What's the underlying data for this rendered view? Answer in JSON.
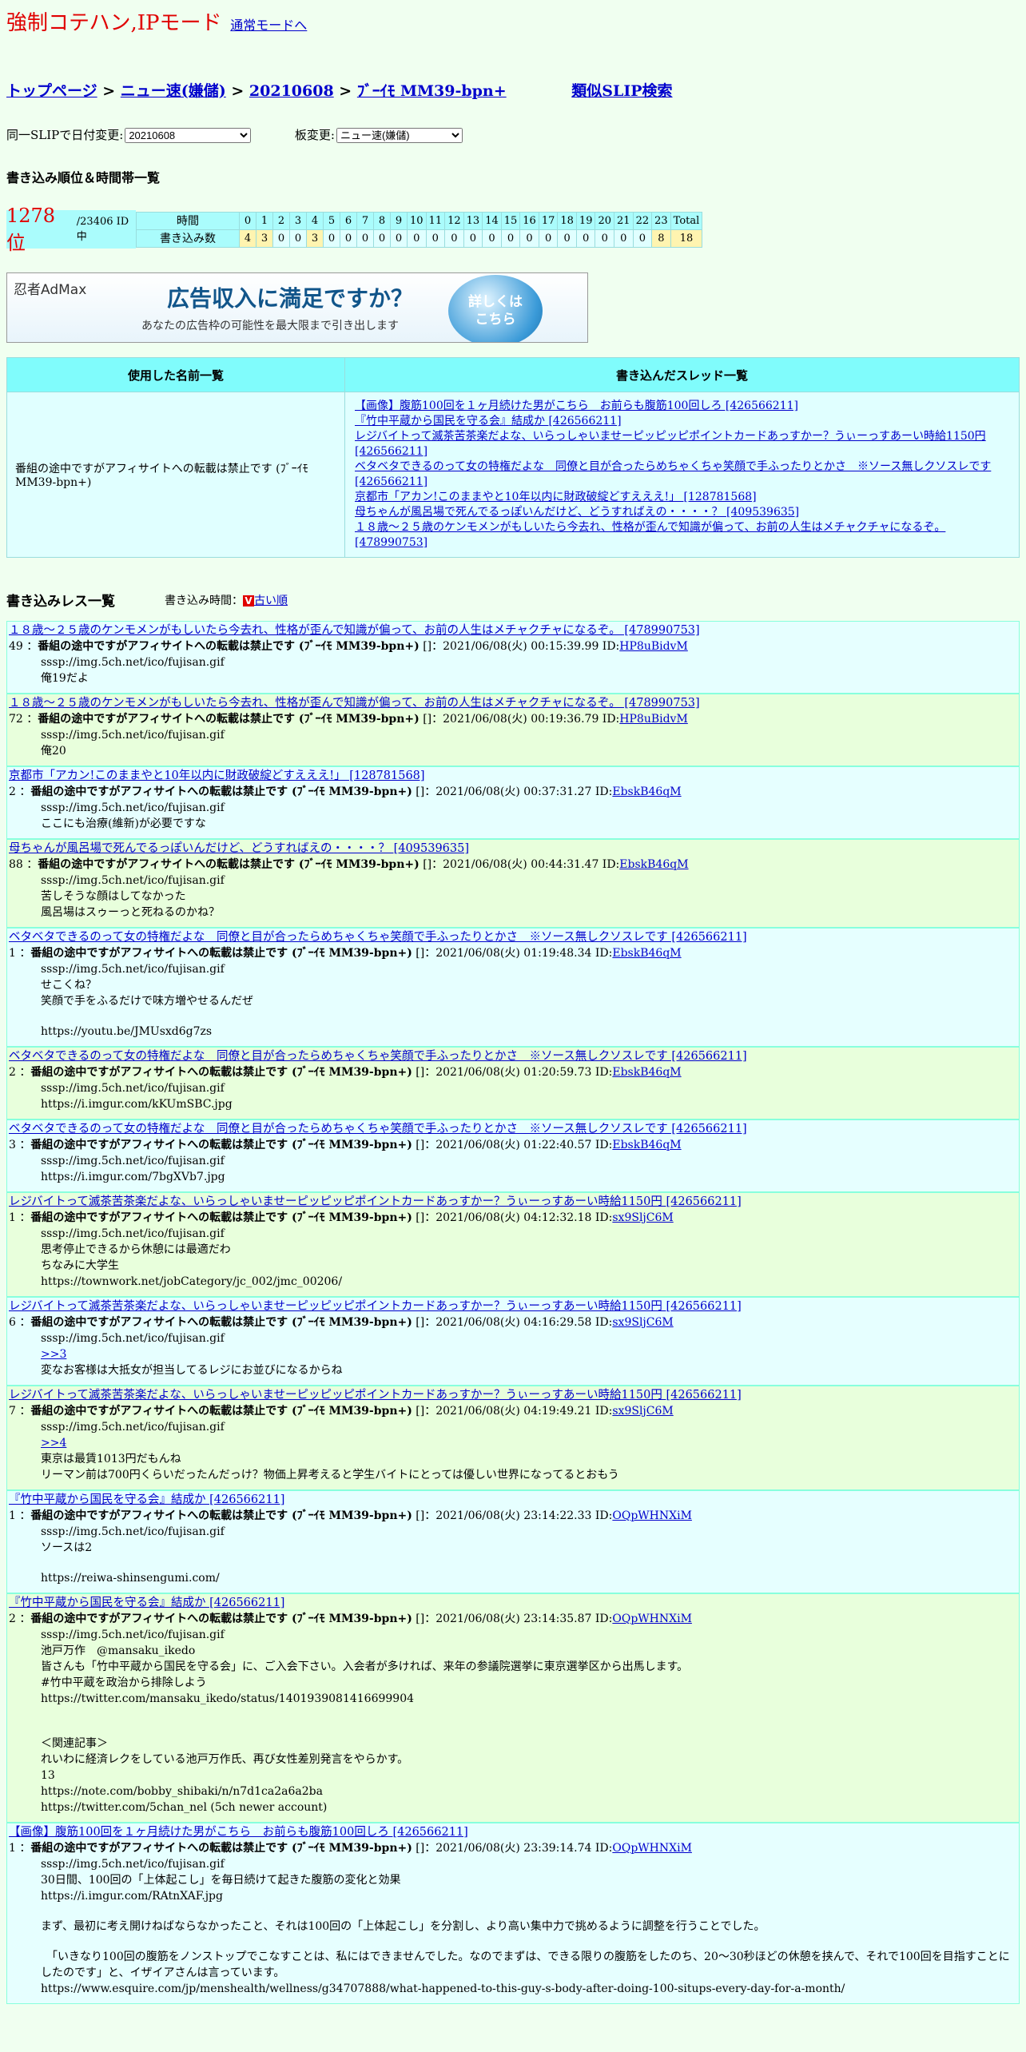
{
  "header": {
    "title": "強制コテハン,IPモード",
    "mode_link": "通常モードへ"
  },
  "breadcrumb": {
    "top": "トップページ",
    "board": "ニュー速(嫌儲)",
    "date": "20210608",
    "slip": "ﾌﾞｰｲﾓ MM39-bpn+",
    "similar": "類似SLIP検索",
    "sep": " > "
  },
  "controls": {
    "date_label": "同一SLIPで日付変更:",
    "date_value": "20210608",
    "board_label": "板変更:",
    "board_value": "ニュー速(嫌儲)"
  },
  "ranking": {
    "heading": "書き込み順位＆時間帯一覧",
    "rank": "1278 位",
    "total": "/23406 ID中",
    "time_label": "時間",
    "count_label": "書き込み数",
    "hours": [
      "0",
      "1",
      "2",
      "3",
      "4",
      "5",
      "6",
      "7",
      "8",
      "9",
      "10",
      "11",
      "12",
      "13",
      "14",
      "15",
      "16",
      "17",
      "18",
      "19",
      "20",
      "21",
      "22",
      "23",
      "Total"
    ],
    "counts": [
      "4",
      "3",
      "0",
      "0",
      "3",
      "0",
      "0",
      "0",
      "0",
      "0",
      "0",
      "0",
      "0",
      "0",
      "0",
      "0",
      "0",
      "0",
      "0",
      "0",
      "0",
      "0",
      "0",
      "8",
      "18"
    ]
  },
  "ad": {
    "logo": "忍者AdMax",
    "main": "広告収入に満足ですか？",
    "sub": "あなたの広告枠の可能性を最大限まで引き出します",
    "button": "詳しくは\nこちら"
  },
  "names": {
    "col1": "使用した名前一覧",
    "col2": "書き込んだスレッド一覧",
    "name": "番組の途中ですがアフィサイトへの転載は禁止です (ﾌﾞｰｲﾓ MM39-bpn+)",
    "threads": [
      "【画像】腹筋100回を１ヶ月続けた男がこちら　お前らも腹筋100回しろ [426566211]",
      "『竹中平蔵から国民を守る会』結成か [426566211]",
      "レジバイトって滅茶苦茶楽だよな、いらっしゃいませーピッピッピポイントカードあっすかー？うぃーっすあーい時給1150円 [426566211]",
      "ベタベタできるのって女の特権だよな　同僚と目が合ったらめちゃくちゃ笑顔で手ふったりとかさ　※ソース無しクソスレです [426566211]",
      "京都市「アカン!このままやと10年以内に財政破綻どすえええ!」 [128781568]",
      "母ちゃんが風呂場で死んでるっぽいんだけど、どうすればえの・・・・？ [409539635]",
      "１８歳〜２５歳のケンモメンがもしいたら今去れ、性格が歪んで知識が偏って、お前の人生はメチャクチャになるぞ。 [478990753]"
    ]
  },
  "reslist": {
    "heading": "書き込みレス一覧",
    "time_label": "書き込み時間：",
    "order": "古い順",
    "v": "V"
  },
  "posts": [
    {
      "thread": "１８歳〜２５歳のケンモメンがもしいたら今去れ、性格が歪んで知識が偏って、お前の人生はメチャクチャになるぞ。 [478990753]",
      "no": "49 ：",
      "name": "番組の途中ですがアフィサイトへの転載は禁止です (ﾌﾞｰｲﾓ MM39-bpn+)",
      "meta": " []：2021/06/08(火) 00:15:39.99 ID:",
      "id": "HP8uBidvM",
      "lines": [
        "sssp://img.5ch.net/ico/fujisan.gif",
        "俺19だよ"
      ]
    },
    {
      "thread": "１８歳〜２５歳のケンモメンがもしいたら今去れ、性格が歪んで知識が偏って、お前の人生はメチャクチャになるぞ。 [478990753]",
      "no": "72 ：",
      "name": "番組の途中ですがアフィサイトへの転載は禁止です (ﾌﾞｰｲﾓ MM39-bpn+)",
      "meta": " []：2021/06/08(火) 00:19:36.79 ID:",
      "id": "HP8uBidvM",
      "lines": [
        "sssp://img.5ch.net/ico/fujisan.gif",
        "俺20"
      ]
    },
    {
      "thread": "京都市「アカン!このままやと10年以内に財政破綻どすえええ!」 [128781568]",
      "no": "2 ：",
      "name": "番組の途中ですがアフィサイトへの転載は禁止です (ﾌﾞｰｲﾓ MM39-bpn+)",
      "meta": " []：2021/06/08(火) 00:37:31.27 ID:",
      "id": "EbskB46qM",
      "lines": [
        "sssp://img.5ch.net/ico/fujisan.gif",
        "ここにも治療(維新)が必要ですな"
      ]
    },
    {
      "thread": "母ちゃんが風呂場で死んでるっぽいんだけど、どうすればえの・・・・？ [409539635]",
      "no": "88 ：",
      "name": "番組の途中ですがアフィサイトへの転載は禁止です (ﾌﾞｰｲﾓ MM39-bpn+)",
      "meta": " []：2021/06/08(火) 00:44:31.47 ID:",
      "id": "EbskB46qM",
      "lines": [
        "sssp://img.5ch.net/ico/fujisan.gif",
        "苦しそうな顔はしてなかった",
        "風呂場はスゥーっと死ねるのかね？"
      ]
    },
    {
      "thread": "ベタベタできるのって女の特権だよな　同僚と目が合ったらめちゃくちゃ笑顔で手ふったりとかさ　※ソース無しクソスレです [426566211]",
      "no": "1 ：",
      "name": "番組の途中ですがアフィサイトへの転載は禁止です (ﾌﾞｰｲﾓ MM39-bpn+)",
      "meta": " []：2021/06/08(火) 01:19:48.34 ID:",
      "id": "EbskB46qM",
      "lines": [
        "sssp://img.5ch.net/ico/fujisan.gif",
        "せこくね？",
        "笑顔で手をふるだけで味方増やせるんだぜ",
        "",
        "https://youtu.be/JMUsxd6g7zs"
      ]
    },
    {
      "thread": "ベタベタできるのって女の特権だよな　同僚と目が合ったらめちゃくちゃ笑顔で手ふったりとかさ　※ソース無しクソスレです [426566211]",
      "no": "2 ：",
      "name": "番組の途中ですがアフィサイトへの転載は禁止です (ﾌﾞｰｲﾓ MM39-bpn+)",
      "meta": " []：2021/06/08(火) 01:20:59.73 ID:",
      "id": "EbskB46qM",
      "lines": [
        "sssp://img.5ch.net/ico/fujisan.gif",
        "https://i.imgur.com/kKUmSBC.jpg"
      ]
    },
    {
      "thread": "ベタベタできるのって女の特権だよな　同僚と目が合ったらめちゃくちゃ笑顔で手ふったりとかさ　※ソース無しクソスレです [426566211]",
      "no": "3 ：",
      "name": "番組の途中ですがアフィサイトへの転載は禁止です (ﾌﾞｰｲﾓ MM39-bpn+)",
      "meta": " []：2021/06/08(火) 01:22:40.57 ID:",
      "id": "EbskB46qM",
      "lines": [
        "sssp://img.5ch.net/ico/fujisan.gif",
        "https://i.imgur.com/7bgXVb7.jpg"
      ]
    },
    {
      "thread": "レジバイトって滅茶苦茶楽だよな、いらっしゃいませーピッピッピポイントカードあっすかー？うぃーっすあーい時給1150円 [426566211]",
      "no": "1 ：",
      "name": "番組の途中ですがアフィサイトへの転載は禁止です (ﾌﾞｰｲﾓ MM39-bpn+)",
      "meta": " []：2021/06/08(火) 04:12:32.18 ID:",
      "id": "sx9SljC6M",
      "lines": [
        "sssp://img.5ch.net/ico/fujisan.gif",
        "思考停止できるから休憩には最適だわ",
        "ちなみに大学生",
        "https://townwork.net/jobCategory/jc_002/jmc_00206/"
      ]
    },
    {
      "thread": "レジバイトって滅茶苦茶楽だよな、いらっしゃいませーピッピッピポイントカードあっすかー？うぃーっすあーい時給1150円 [426566211]",
      "no": "6 ：",
      "name": "番組の途中ですがアフィサイトへの転載は禁止です (ﾌﾞｰｲﾓ MM39-bpn+)",
      "meta": " []：2021/06/08(火) 04:16:29.58 ID:",
      "id": "sx9SljC6M",
      "lines": [
        "sssp://img.5ch.net/ico/fujisan.gif",
        ">>3",
        "変なお客様は大抵女が担当してるレジにお並びになるからね"
      ]
    },
    {
      "thread": "レジバイトって滅茶苦茶楽だよな、いらっしゃいませーピッピッピポイントカードあっすかー？うぃーっすあーい時給1150円 [426566211]",
      "no": "7 ：",
      "name": "番組の途中ですがアフィサイトへの転載は禁止です (ﾌﾞｰｲﾓ MM39-bpn+)",
      "meta": " []：2021/06/08(火) 04:19:49.21 ID:",
      "id": "sx9SljC6M",
      "lines": [
        "sssp://img.5ch.net/ico/fujisan.gif",
        ">>4",
        "東京は最賃1013円だもんね",
        "リーマン前は700円くらいだったんだっけ？物価上昇考えると学生バイトにとっては優しい世界になってるとおもう"
      ]
    },
    {
      "thread": "『竹中平蔵から国民を守る会』結成か [426566211]",
      "no": "1 ：",
      "name": "番組の途中ですがアフィサイトへの転載は禁止です (ﾌﾞｰｲﾓ MM39-bpn+)",
      "meta": " []：2021/06/08(火) 23:14:22.33 ID:",
      "id": "OQpWHNXiM",
      "lines": [
        "sssp://img.5ch.net/ico/fujisan.gif",
        "ソースは2",
        "",
        "https://reiwa-shinsengumi.com/"
      ]
    },
    {
      "thread": "『竹中平蔵から国民を守る会』結成か [426566211]",
      "no": "2 ：",
      "name": "番組の途中ですがアフィサイトへの転載は禁止です (ﾌﾞｰｲﾓ MM39-bpn+)",
      "meta": " []：2021/06/08(火) 23:14:35.87 ID:",
      "id": "OQpWHNXiM",
      "lines": [
        "sssp://img.5ch.net/ico/fujisan.gif",
        "池戸万作　@mansaku_ikedo",
        "皆さんも「竹中平蔵から国民を守る会」に、ご入会下さい。入会者が多ければ、来年の参議院選挙に東京選挙区から出馬します。",
        "#竹中平蔵を政治から排除しよう",
        "https://twitter.com/mansaku_ikedo/status/1401939081416699904",
        "",
        "",
        "＜関連記事＞",
        "れいわに経済レクをしている池戸万作氏、再び女性差別発言をやらかす。",
        "13",
        "https://note.com/bobby_shibaki/n/n7d1ca2a6a2ba",
        "https://twitter.com/5chan_nel (5ch newer account)"
      ]
    },
    {
      "thread": "【画像】腹筋100回を１ヶ月続けた男がこちら　お前らも腹筋100回しろ [426566211]",
      "no": "1 ：",
      "name": "番組の途中ですがアフィサイトへの転載は禁止です (ﾌﾞｰｲﾓ MM39-bpn+)",
      "meta": " []：2021/06/08(火) 23:39:14.74 ID:",
      "id": "OQpWHNXiM",
      "lines": [
        "sssp://img.5ch.net/ico/fujisan.gif",
        "30日間、100回の「上体起こし」を毎日続けて起きた腹筋の変化と効果",
        "https://i.imgur.com/RAtnXAF.jpg",
        "",
        "まず、最初に考え開けねばならなかったこと、それは100回の「上体起こし」を分割し、より高い集中力で挑めるように調整を行うことでした。",
        "",
        "　「いきなり100回の腹筋をノンストップでこなすことは、私にはできませんでした。なのでまずは、できる限りの腹筋をしたのち、20～30秒ほどの休憩を挟んで、それで100回を目指すことにしたのです」と、イザイアさんは言っています。",
        "https://www.esquire.com/jp/menshealth/wellness/g34707888/what-happened-to-this-guy-s-body-after-doing-100-situps-every-day-for-a-month/"
      ]
    }
  ]
}
